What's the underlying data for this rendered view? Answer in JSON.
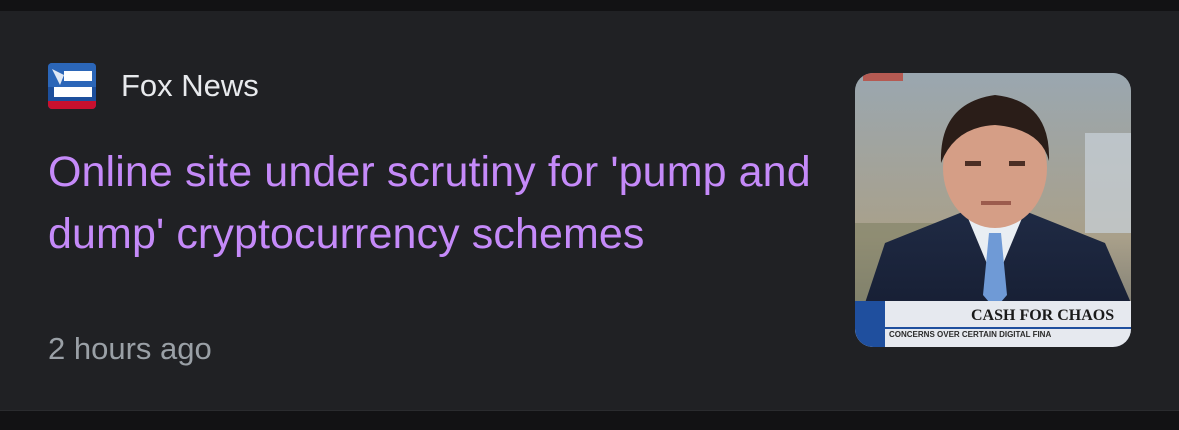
{
  "article": {
    "source_name": "Fox News",
    "source_logo_icon": "fox-news-logo-icon",
    "headline": "Online site under scrutiny for 'pump and dump' cryptocurrency schemes",
    "timestamp": "2 hours ago",
    "thumbnail_icon": "news-anchor-thumbnail",
    "thumbnail_chyron_text": "CASH FOR CHAOS",
    "thumbnail_chyron_subtext": "CONCERNS OVER CERTAIN DIGITAL FINA"
  },
  "colors": {
    "background": "#202124",
    "headline": "#c58af9",
    "source": "#e8eaed",
    "timestamp": "#9aa0a6"
  }
}
